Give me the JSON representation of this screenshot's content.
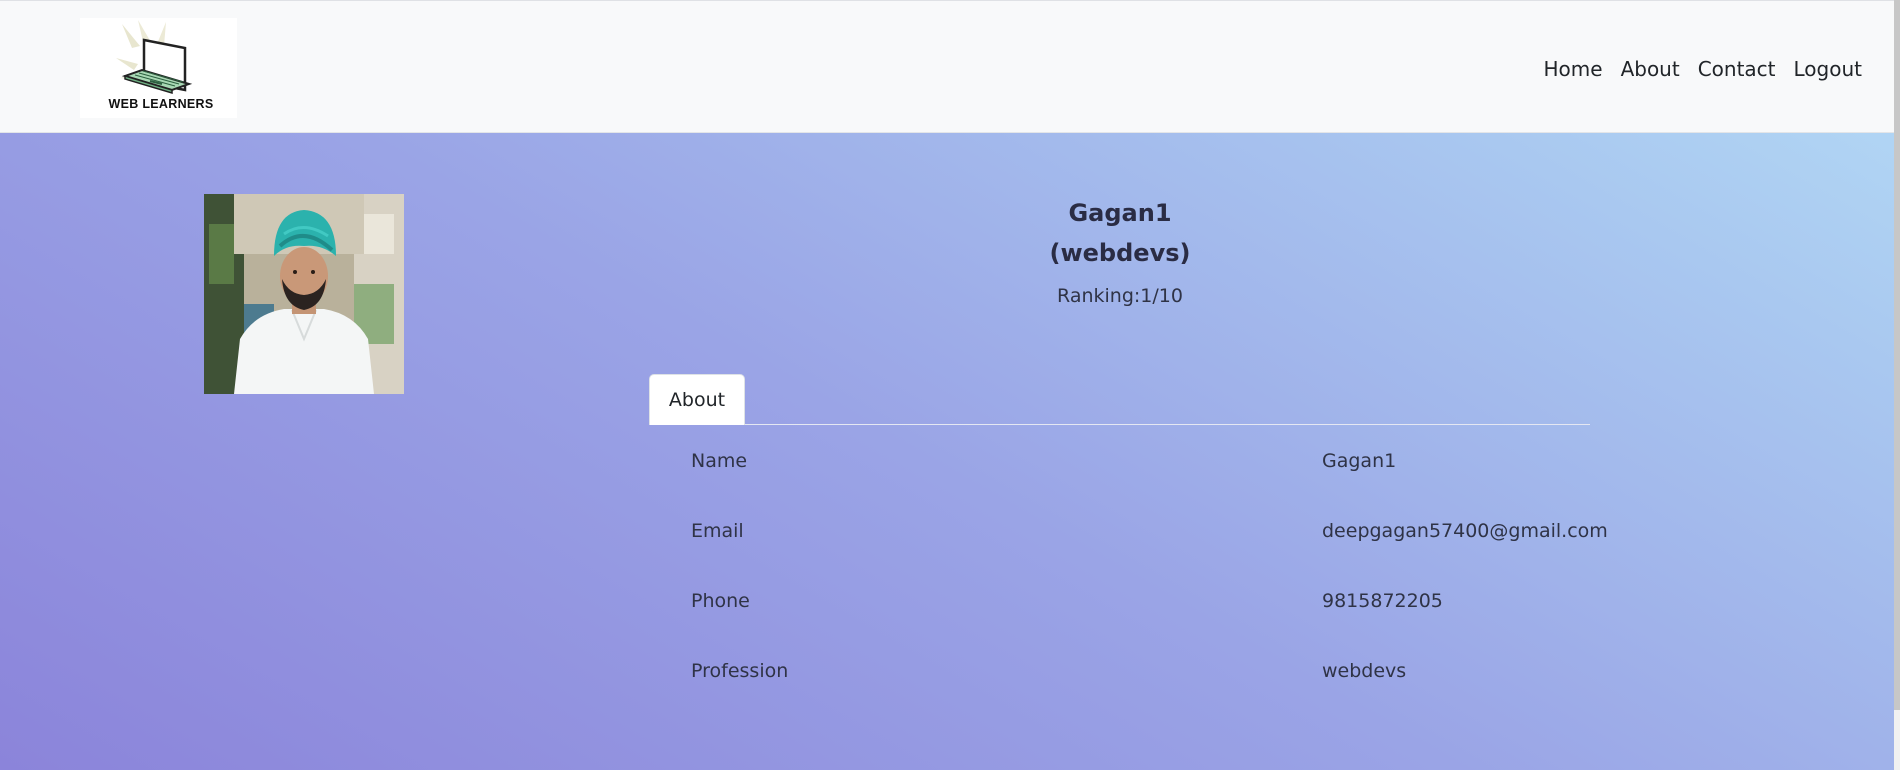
{
  "brand": {
    "logo_text": "WEB LEARNERS"
  },
  "nav": {
    "items": [
      "Home",
      "About",
      "Contact",
      "Logout"
    ]
  },
  "profile": {
    "name": "Gagan1",
    "work": "(webdevs)",
    "ranking": "Ranking:1/10"
  },
  "tabs": {
    "active": "About"
  },
  "details": [
    {
      "label": "Name",
      "value": "Gagan1"
    },
    {
      "label": "Email",
      "value": "deepgagan57400@gmail.com"
    },
    {
      "label": "Phone",
      "value": "9815872205"
    },
    {
      "label": "Profession",
      "value": "webdevs"
    }
  ],
  "colors": {
    "navbar_bg": "#f8f9fa",
    "gradient_start": "#8b84da",
    "gradient_end": "#b5dcf6",
    "text": "#2f3346"
  }
}
